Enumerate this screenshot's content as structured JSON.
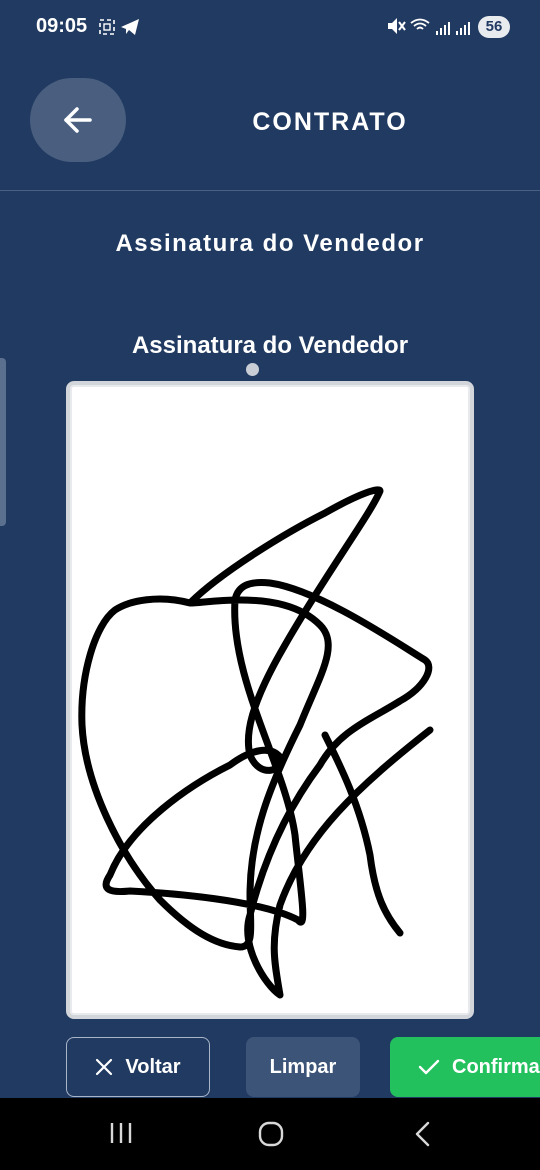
{
  "status_bar": {
    "time": "09:05",
    "battery": "56",
    "icons": [
      "screen-record-icon",
      "telegram-icon",
      "mute-icon",
      "wifi-icon",
      "signal-icon",
      "signal-icon"
    ]
  },
  "header": {
    "back_icon": "arrow-left-icon",
    "title": "CONTRATO"
  },
  "page": {
    "subtitle": "Assinatura do Vendedor"
  },
  "signature": {
    "label": "Assinatura do Vendedor"
  },
  "actions": {
    "back_label": "Voltar",
    "back_icon": "close-icon",
    "clear_label": "Limpar",
    "confirm_label": "Confirmar",
    "confirm_icon": "check-icon"
  },
  "navigation": {
    "items": [
      "recent-apps-icon",
      "home-icon",
      "back-icon"
    ]
  },
  "colors": {
    "background": "#213a61",
    "confirm": "#22c15e",
    "clear": "#3b5478"
  }
}
